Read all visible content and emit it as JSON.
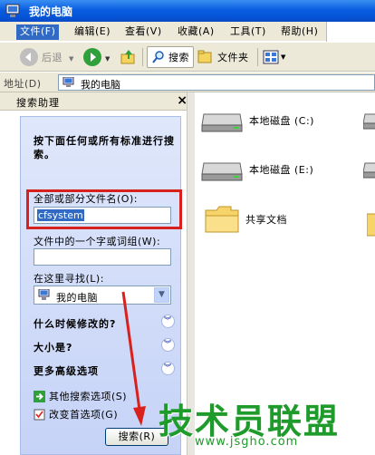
{
  "window": {
    "title": "我的电脑"
  },
  "menu": [
    {
      "label": "文件(F)",
      "active": true
    },
    {
      "label": "编辑(E)"
    },
    {
      "label": "查看(V)"
    },
    {
      "label": "收藏(A)"
    },
    {
      "label": "工具(T)"
    },
    {
      "label": "帮助(H)"
    }
  ],
  "toolbar": {
    "back_label": "后退",
    "search_label": "搜索",
    "folders_label": "文件夹"
  },
  "address": {
    "label": "地址(D)",
    "value": "我的电脑"
  },
  "search_pane": {
    "title": "搜索助理",
    "close_glyph": "×",
    "prompt": "按下面任何或所有标准进行搜索。",
    "filename_label": "全部或部分文件名(O):",
    "filename_value": "cfsystem",
    "phrase_label": "文件中的一个字或词组(W):",
    "phrase_value": "",
    "lookin_label": "在这里寻找(L):",
    "lookin_value": "我的电脑",
    "when_modified": "什么时候修改的?",
    "size": "大小是?",
    "advanced": "更多高级选项",
    "other_options": "其他搜索选项(S)",
    "preferences": "改变首选项(G)",
    "search_button": "搜索(R)"
  },
  "content": {
    "items": [
      {
        "label": "本地磁盘 (C:)",
        "icon": "drive-icon"
      },
      {
        "label": "本地磁盘 (E:)",
        "icon": "drive-icon"
      },
      {
        "label": "共享文档",
        "icon": "folder-icon"
      }
    ]
  },
  "watermark": {
    "text": "技术员联盟",
    "url": "www.jsgho.com"
  },
  "colors": {
    "titlebar": "#0553d6",
    "selection": "#316ac5",
    "highlight_box": "#d8211d",
    "annotation_arrow": "#d8211d",
    "watermark": "#1e9b2a"
  }
}
